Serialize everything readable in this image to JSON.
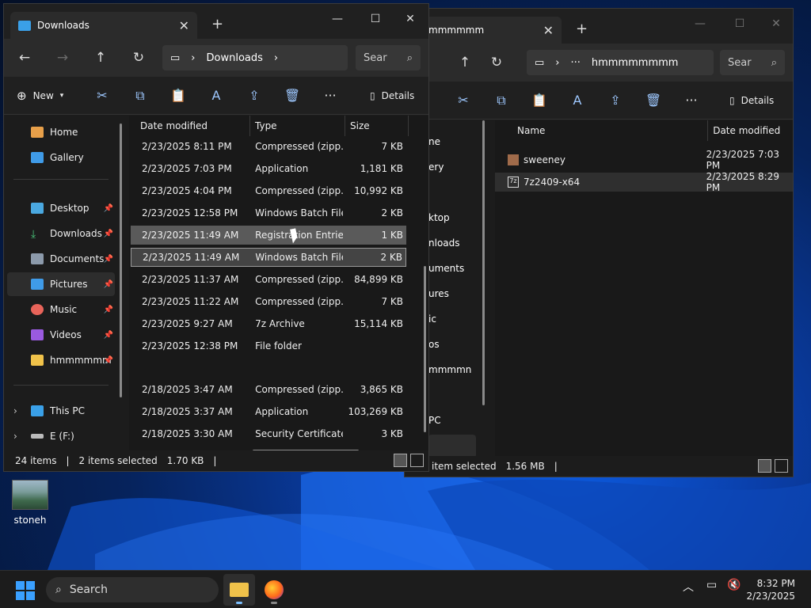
{
  "desktop": {
    "icon_label": "stoneh"
  },
  "win_left": {
    "tab_title": "Downloads",
    "breadcrumb": "Downloads",
    "search_placeholder": "Sear",
    "toolbar": {
      "new_label": "New",
      "details_label": "Details"
    },
    "sidebar": {
      "home": "Home",
      "gallery": "Gallery",
      "desktop": "Desktop",
      "downloads": "Downloads",
      "documents": "Documents",
      "pictures": "Pictures",
      "music": "Music",
      "videos": "Videos",
      "hmm": "hmmmmmm",
      "thispc": "This PC",
      "edrive": "E (F:)"
    },
    "columns": {
      "date": "Date modified",
      "type": "Type",
      "size": "Size"
    },
    "rows": [
      {
        "date": "2/23/2025 8:11 PM",
        "type": "Compressed (zipp...",
        "size": "7 KB"
      },
      {
        "date": "2/23/2025 7:03 PM",
        "type": "Application",
        "size": "1,181 KB"
      },
      {
        "date": "2/23/2025 4:04 PM",
        "type": "Compressed (zipp...",
        "size": "10,992 KB"
      },
      {
        "date": "2/23/2025 12:58 PM",
        "type": "Windows Batch File",
        "size": "2 KB"
      },
      {
        "date": "2/23/2025 11:49 AM",
        "type": "Registration Entries",
        "size": "1 KB"
      },
      {
        "date": "2/23/2025 11:49 AM",
        "type": "Windows Batch File",
        "size": "2 KB"
      },
      {
        "date": "2/23/2025 11:37 AM",
        "type": "Compressed (zipp...",
        "size": "84,899 KB"
      },
      {
        "date": "2/23/2025 11:22 AM",
        "type": "Compressed (zipp...",
        "size": "7 KB"
      },
      {
        "date": "2/23/2025 9:27 AM",
        "type": "7z Archive",
        "size": "15,114 KB"
      },
      {
        "date": "2/23/2025 12:38 PM",
        "type": "File folder",
        "size": ""
      },
      {
        "date": "2/18/2025 3:47 AM",
        "type": "Compressed (zipp...",
        "size": "3,865 KB"
      },
      {
        "date": "2/18/2025 3:37 AM",
        "type": "Application",
        "size": "103,269 KB"
      },
      {
        "date": "2/18/2025 3:30 AM",
        "type": "Security Certificate",
        "size": "3 KB"
      }
    ],
    "status": {
      "items": "24 items",
      "selected": "2 items selected",
      "size": "1.70 KB"
    }
  },
  "win_right": {
    "tab_title": "mmmmmm",
    "breadcrumb": "hmmmmmmmm",
    "search_placeholder": "Sear",
    "details_label": "Details",
    "sidebar_partial": [
      "ne",
      "ery",
      "ktop",
      "nloads",
      "uments",
      "ures",
      "ic",
      "os",
      "mmmmn",
      "PC"
    ],
    "columns": {
      "name": "Name",
      "date": "Date modified"
    },
    "rows": [
      {
        "name": "sweeney",
        "date": "2/23/2025 7:03 PM"
      },
      {
        "name": "7z2409-x64",
        "date": "2/23/2025 8:29 PM"
      }
    ],
    "status": {
      "selected": "item selected",
      "size": "1.56 MB"
    }
  },
  "taskbar": {
    "search_label": "Search",
    "time": "8:32 PM",
    "date": "2/23/2025"
  }
}
